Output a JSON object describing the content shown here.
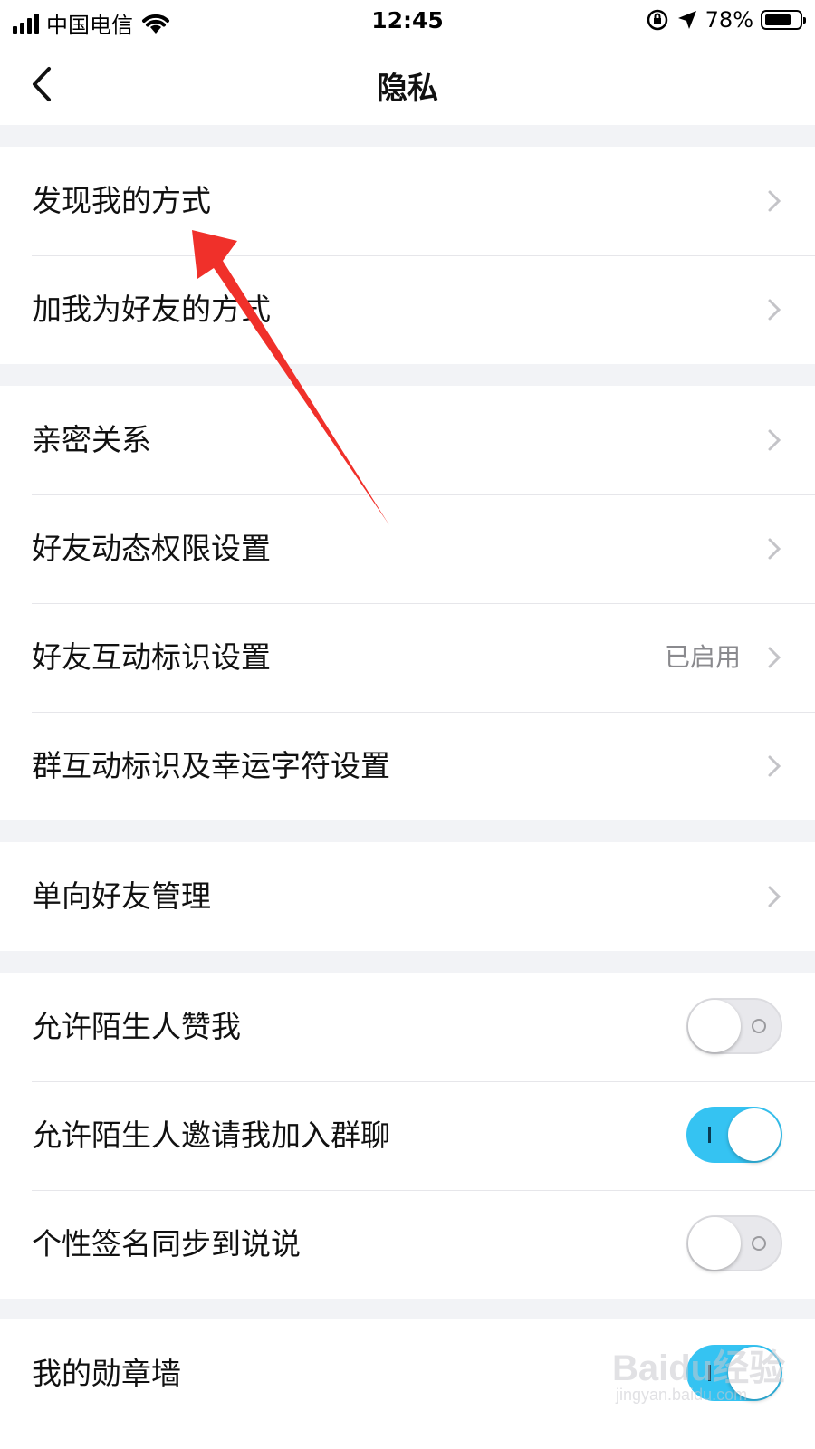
{
  "statusbar": {
    "carrier": "中国电信",
    "time": "12:45",
    "battery": "78%",
    "battery_level": 0.78
  },
  "nav": {
    "title": "隐私"
  },
  "groups": [
    {
      "items": [
        {
          "label": "发现我的方式"
        },
        {
          "label": "加我为好友的方式"
        }
      ]
    },
    {
      "items": [
        {
          "label": "亲密关系"
        },
        {
          "label": "好友动态权限设置"
        },
        {
          "label": "好友互动标识设置",
          "value": "已启用"
        },
        {
          "label": "群互动标识及幸运字符设置"
        }
      ]
    },
    {
      "items": [
        {
          "label": "单向好友管理"
        }
      ]
    },
    {
      "items": [
        {
          "label": "允许陌生人赞我",
          "toggle": "off"
        },
        {
          "label": "允许陌生人邀请我加入群聊",
          "toggle": "on"
        },
        {
          "label": "个性签名同步到说说",
          "toggle": "off"
        }
      ]
    },
    {
      "items": [
        {
          "label": "我的勋章墙",
          "toggle": "on"
        }
      ]
    }
  ],
  "colors": {
    "toggle_on": "#35c3f2",
    "annotation_arrow": "#f0302a"
  },
  "watermark": {
    "brand": "Baidu经验",
    "url": "jingyan.baidu.com"
  }
}
